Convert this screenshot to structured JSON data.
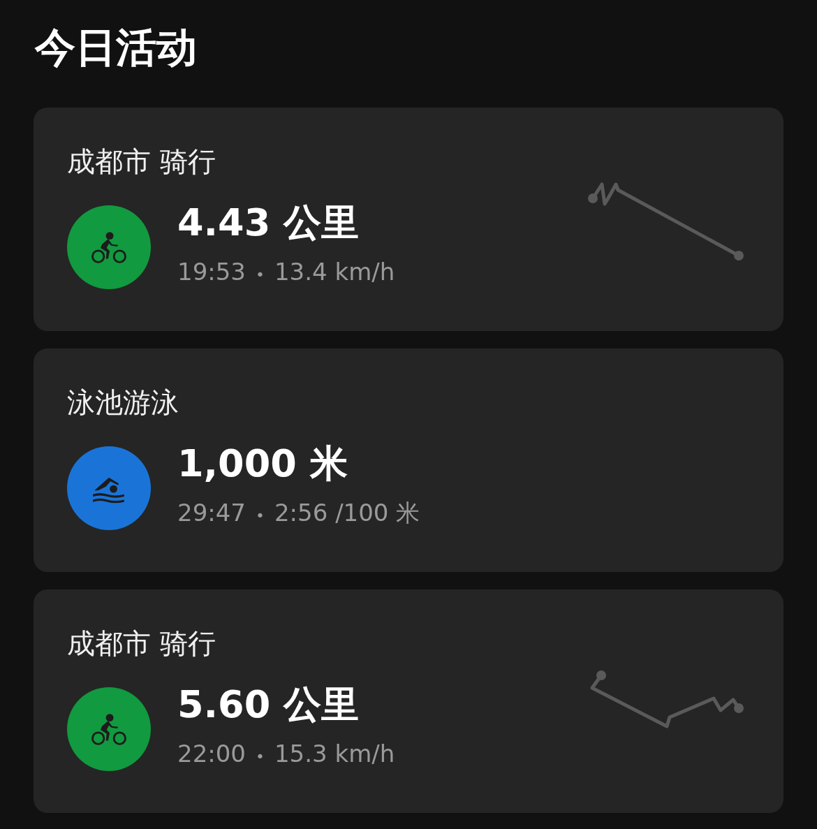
{
  "header": {
    "title": "今日活动"
  },
  "activities": [
    {
      "kind": "cycling",
      "title": "成都市 骑行",
      "distance": "4.43 公里",
      "time": "19:53",
      "separator": "•",
      "pace": "13.4 km/h",
      "color": "#119a3f",
      "route_map": true
    },
    {
      "kind": "swimming",
      "title": "泳池游泳",
      "distance": "1,000 米",
      "time": "29:47",
      "separator": "•",
      "pace": "2:56 /100 米",
      "color": "#1a74d8",
      "route_map": false
    },
    {
      "kind": "cycling",
      "title": "成都市 骑行",
      "distance": "5.60 公里",
      "time": "22:00",
      "separator": "•",
      "pace": "15.3 km/h",
      "color": "#119a3f",
      "route_map": true
    }
  ]
}
